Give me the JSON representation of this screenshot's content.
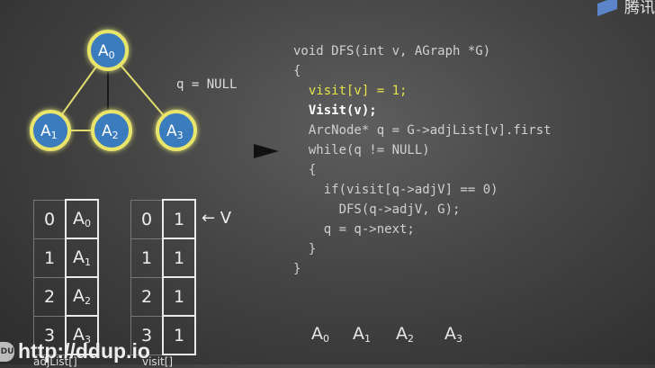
{
  "graph": {
    "nodes": [
      {
        "base": "A",
        "sub": "0"
      },
      {
        "base": "A",
        "sub": "1"
      },
      {
        "base": "A",
        "sub": "2"
      },
      {
        "base": "A",
        "sub": "3"
      }
    ],
    "colors": {
      "node_fill": "#3b7bbf",
      "node_glow": "#e9e46a",
      "visited_edge": "#e1dc6e",
      "plain_edge": "#1a1a1a"
    }
  },
  "q_note": "q = NULL",
  "code": {
    "line1": "void DFS(int v, AGraph *G)",
    "line2": "{",
    "line3": "visit[v] = 1;",
    "line4": "Visit(v);",
    "line5": "ArcNode* q = G->adjList[v].first",
    "line6": "while(q != NULL)",
    "line7": "{",
    "line8": "if(visit[q->adjV] == 0)",
    "line9": "DFS(q->adjV, G);",
    "line10": "q = q->next;",
    "line11": "}",
    "line12": "}"
  },
  "adjList": {
    "caption": "adjList[]",
    "rows": [
      {
        "index": "0",
        "base": "A",
        "sub": "0"
      },
      {
        "index": "1",
        "base": "A",
        "sub": "1"
      },
      {
        "index": "2",
        "base": "A",
        "sub": "2"
      },
      {
        "index": "3",
        "base": "A",
        "sub": "3"
      }
    ]
  },
  "visit": {
    "caption": "visit[]",
    "pointer": "← V",
    "rows": [
      {
        "index": "0",
        "value": "1"
      },
      {
        "index": "1",
        "value": "1"
      },
      {
        "index": "2",
        "value": "1"
      },
      {
        "index": "3",
        "value": "1"
      }
    ]
  },
  "sequence": [
    {
      "base": "A",
      "sub": "0"
    },
    {
      "base": "A",
      "sub": "1"
    },
    {
      "base": "A",
      "sub": "2"
    },
    {
      "base": "A",
      "sub": "3"
    }
  ],
  "watermark": {
    "logo": "DU",
    "url": "http://ddup.io"
  },
  "corner_label": "腾讯"
}
